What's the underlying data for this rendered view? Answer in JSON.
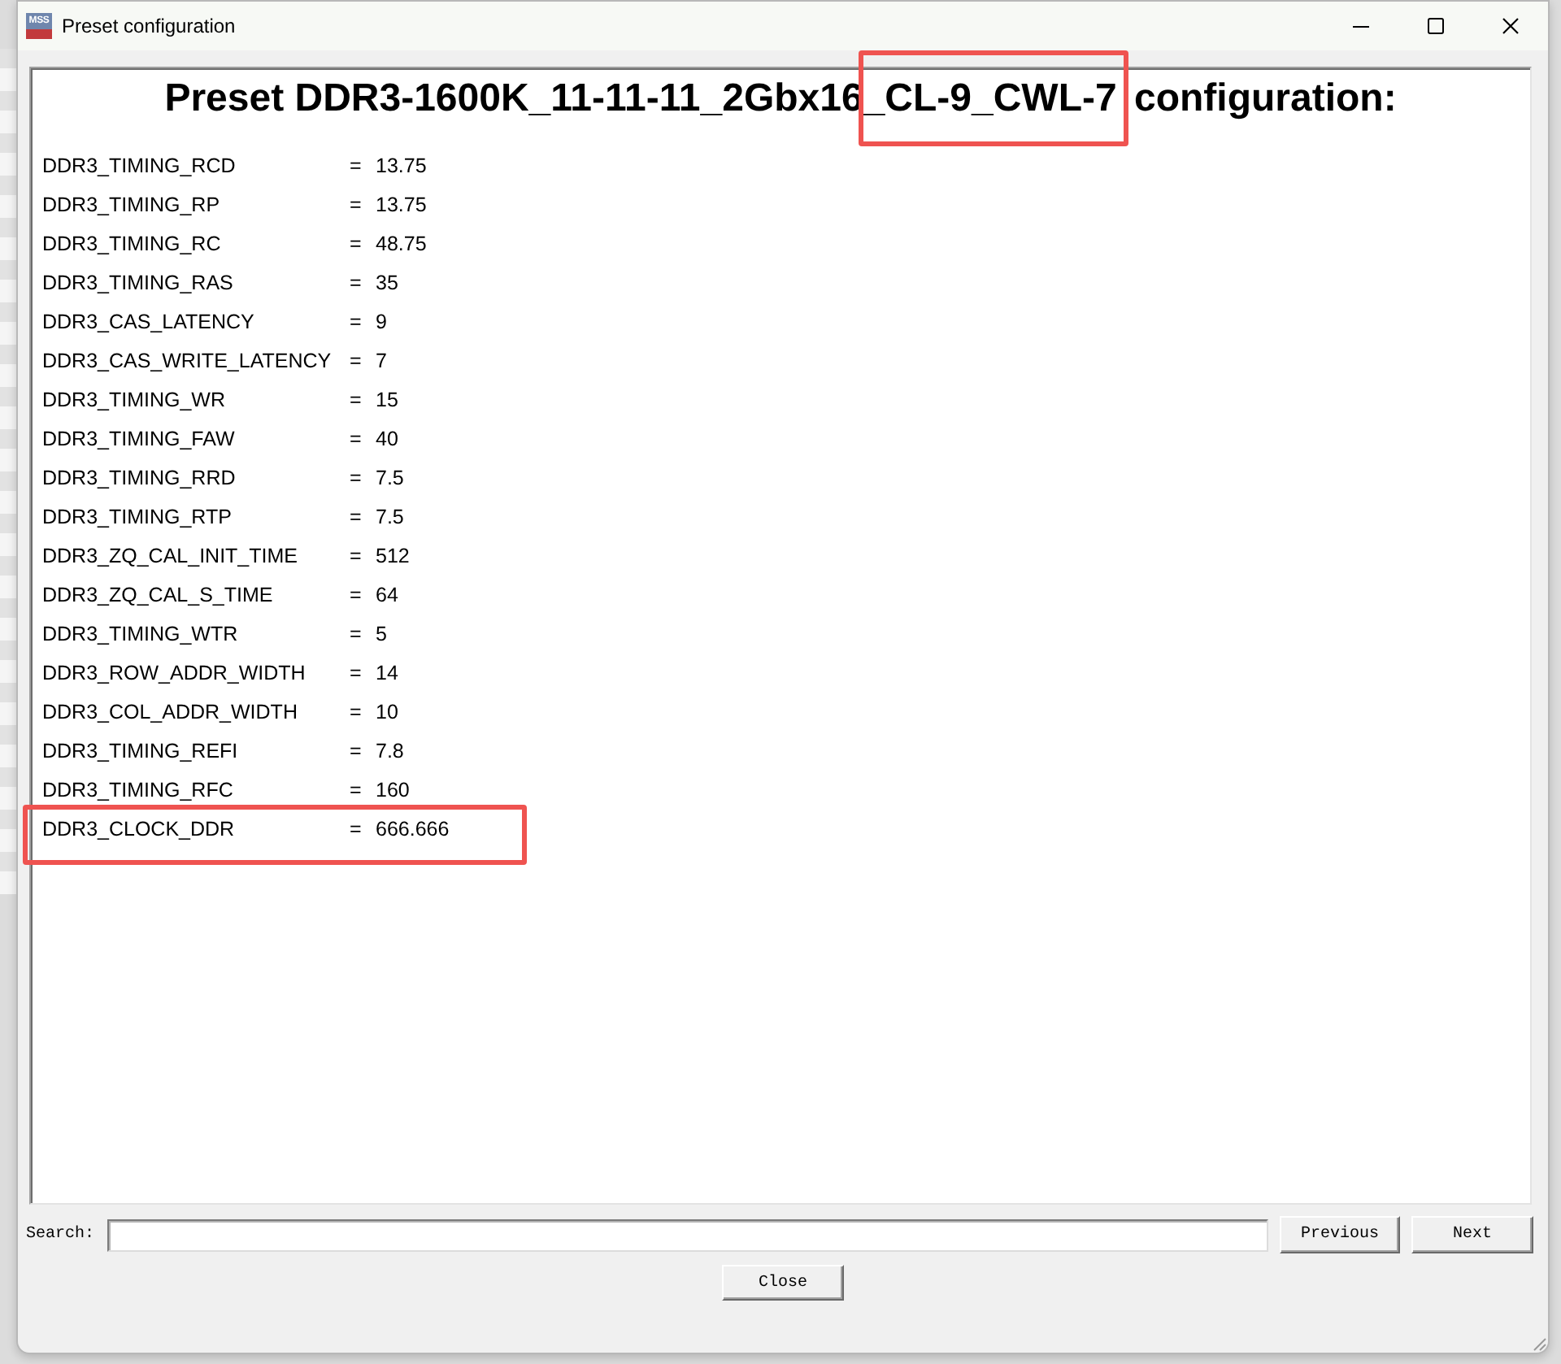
{
  "window": {
    "title": "Preset configuration",
    "app_icon": "MSS"
  },
  "heading": {
    "parts": [
      {
        "text": "Preset DDR3-1600K_11-11-11_2Gbx16",
        "highlighted": false
      },
      {
        "text": "_CL-9_CWL-7",
        "highlighted": true
      },
      {
        "text": " configuration:",
        "highlighted": false
      }
    ]
  },
  "parameters": [
    {
      "name": "DDR3_TIMING_RCD",
      "sep": "=",
      "value": "13.75",
      "highlighted": false
    },
    {
      "name": "DDR3_TIMING_RP",
      "sep": "=",
      "value": "13.75",
      "highlighted": false
    },
    {
      "name": "DDR3_TIMING_RC",
      "sep": "=",
      "value": "48.75",
      "highlighted": false
    },
    {
      "name": "DDR3_TIMING_RAS",
      "sep": "=",
      "value": "35",
      "highlighted": false
    },
    {
      "name": "DDR3_CAS_LATENCY",
      "sep": "=",
      "value": "9",
      "highlighted": false
    },
    {
      "name": "DDR3_CAS_WRITE_LATENCY",
      "sep": "=",
      "value": "7",
      "highlighted": false
    },
    {
      "name": "DDR3_TIMING_WR",
      "sep": "=",
      "value": "15",
      "highlighted": false
    },
    {
      "name": "DDR3_TIMING_FAW",
      "sep": "=",
      "value": "40",
      "highlighted": false
    },
    {
      "name": "DDR3_TIMING_RRD",
      "sep": "=",
      "value": "7.5",
      "highlighted": false
    },
    {
      "name": "DDR3_TIMING_RTP",
      "sep": "=",
      "value": "7.5",
      "highlighted": false
    },
    {
      "name": "DDR3_ZQ_CAL_INIT_TIME",
      "sep": "=",
      "value": "512",
      "highlighted": false
    },
    {
      "name": "DDR3_ZQ_CAL_S_TIME",
      "sep": "=",
      "value": "64",
      "highlighted": false
    },
    {
      "name": "DDR3_TIMING_WTR",
      "sep": "=",
      "value": "5",
      "highlighted": false
    },
    {
      "name": "DDR3_ROW_ADDR_WIDTH",
      "sep": "=",
      "value": "14",
      "highlighted": false
    },
    {
      "name": "DDR3_COL_ADDR_WIDTH",
      "sep": "=",
      "value": "10",
      "highlighted": false
    },
    {
      "name": "DDR3_TIMING_REFI",
      "sep": "=",
      "value": "7.8",
      "highlighted": false
    },
    {
      "name": "DDR3_TIMING_RFC",
      "sep": "=",
      "value": "160",
      "highlighted": false
    },
    {
      "name": "DDR3_CLOCK_DDR",
      "sep": "=",
      "value": "666.666",
      "highlighted": true
    }
  ],
  "search": {
    "label": "Search:"
  },
  "nav_buttons": [
    {
      "label": "Previous"
    },
    {
      "label": "Next"
    }
  ],
  "close_button": {
    "label": "Close"
  }
}
